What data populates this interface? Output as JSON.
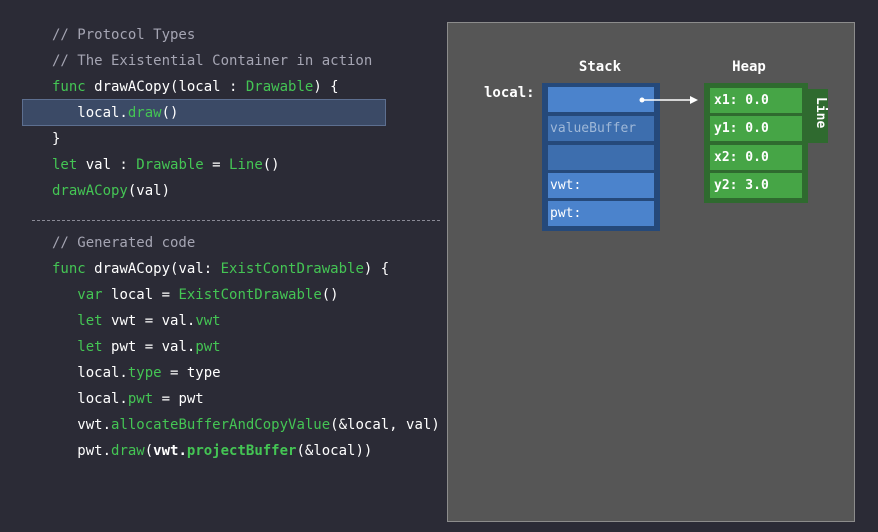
{
  "code_top": [
    [
      {
        "t": "// Protocol Types",
        "c": "comment"
      }
    ],
    [
      {
        "t": "// The Existential Container in action",
        "c": "comment"
      }
    ],
    [
      {
        "t": "func ",
        "c": "kw"
      },
      {
        "t": "drawACopy(local : ",
        "c": "plain"
      },
      {
        "t": "Drawable",
        "c": "type"
      },
      {
        "t": ") {",
        "c": "plain"
      }
    ],
    [
      {
        "t": "   local.",
        "c": "plain"
      },
      {
        "t": "draw",
        "c": "call"
      },
      {
        "t": "()",
        "c": "plain"
      }
    ],
    [
      {
        "t": "}",
        "c": "plain"
      }
    ],
    [
      {
        "t": "let ",
        "c": "kw"
      },
      {
        "t": "val : ",
        "c": "plain"
      },
      {
        "t": "Drawable",
        "c": "type"
      },
      {
        "t": " = ",
        "c": "plain"
      },
      {
        "t": "Line",
        "c": "type"
      },
      {
        "t": "()",
        "c": "plain"
      }
    ],
    [
      {
        "t": "drawACopy",
        "c": "call"
      },
      {
        "t": "(val)",
        "c": "plain"
      }
    ]
  ],
  "code_bottom": [
    [
      {
        "t": "// Generated code",
        "c": "comment"
      }
    ],
    [
      {
        "t": "func ",
        "c": "kw"
      },
      {
        "t": "drawACopy(val: ",
        "c": "plain"
      },
      {
        "t": "ExistContDrawable",
        "c": "type"
      },
      {
        "t": ") {",
        "c": "plain"
      }
    ],
    [
      {
        "t": "   var ",
        "c": "kw"
      },
      {
        "t": "local = ",
        "c": "plain"
      },
      {
        "t": "ExistContDrawable",
        "c": "type"
      },
      {
        "t": "()",
        "c": "plain"
      }
    ],
    [
      {
        "t": "   let ",
        "c": "kw"
      },
      {
        "t": "vwt = val.",
        "c": "plain"
      },
      {
        "t": "vwt",
        "c": "call"
      }
    ],
    [
      {
        "t": "   let ",
        "c": "kw"
      },
      {
        "t": "pwt = val.",
        "c": "plain"
      },
      {
        "t": "pwt",
        "c": "call"
      }
    ],
    [
      {
        "t": "   local.",
        "c": "plain"
      },
      {
        "t": "type",
        "c": "call"
      },
      {
        "t": " = type",
        "c": "plain"
      }
    ],
    [
      {
        "t": "   local.",
        "c": "plain"
      },
      {
        "t": "pwt",
        "c": "call"
      },
      {
        "t": " = pwt",
        "c": "plain"
      }
    ],
    [
      {
        "t": "   vwt.",
        "c": "plain"
      },
      {
        "t": "allocateBufferAndCopyValue",
        "c": "call"
      },
      {
        "t": "(&local, val)",
        "c": "plain"
      }
    ],
    [
      {
        "t": "   pwt.",
        "c": "plain"
      },
      {
        "t": "draw",
        "c": "call"
      },
      {
        "t": "(",
        "c": "plain"
      },
      {
        "t": "vwt.",
        "c": "bold"
      },
      {
        "t": "projectBuffer",
        "c": "boldcall"
      },
      {
        "t": "(&local))",
        "c": "plain"
      }
    ]
  ],
  "diagram": {
    "stack_header": "Stack",
    "heap_header": "Heap",
    "local_label": "local:",
    "stack_cells": [
      "",
      "valueBuffer",
      "",
      "vwt:",
      "pwt:"
    ],
    "heap_cells": [
      "x1: 0.0",
      "y1: 0.0",
      "x2: 0.0",
      "y2: 3.0"
    ],
    "heap_type_label": "Line"
  },
  "colors": {
    "background": "#2b2b36",
    "keyword_green": "#44c554",
    "comment_gray": "#a5a5b3",
    "stack_blue": "#4b83cc",
    "heap_green": "#46a546",
    "panel_gray": "#565656"
  }
}
